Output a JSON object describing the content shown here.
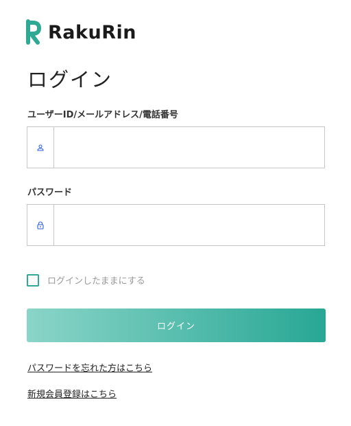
{
  "brand": {
    "name": "RakuRin",
    "accent_color": "#2fa894"
  },
  "page": {
    "title": "ログイン"
  },
  "form": {
    "user_id": {
      "label": "ユーザーID/メールアドレス/電話番号",
      "value": "",
      "icon": "user-icon"
    },
    "password": {
      "label": "パスワード",
      "value": "",
      "icon": "lock-icon"
    },
    "remember": {
      "label": "ログインしたままにする",
      "checked": false
    },
    "submit_label": "ログイン"
  },
  "links": {
    "forgot_password": "パスワードを忘れた方はこちら",
    "register": "新規会員登録はこちら"
  }
}
